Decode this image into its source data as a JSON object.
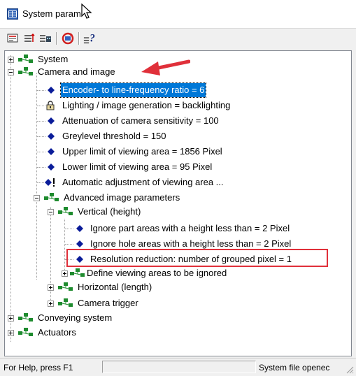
{
  "window": {
    "title": "System param"
  },
  "toolbar": {
    "buttons": [
      "open-icon",
      "save-icon",
      "find-icon",
      "refresh-icon",
      "help-icon"
    ],
    "help_glyph": "?"
  },
  "tree": {
    "items": [
      {
        "label": "System"
      },
      {
        "label": "Camera and image"
      },
      {
        "label": "Encoder- to line-frequency ratio = 6"
      },
      {
        "label": "Lighting / image generation = backlighting"
      },
      {
        "label": "Attenuation of camera sensitivity = 100"
      },
      {
        "label": "Greylevel threshold = 150"
      },
      {
        "label": "Upper limit of viewing area = 1856 Pixel"
      },
      {
        "label": "Lower limit of viewing area = 95 Pixel"
      },
      {
        "label": "Automatic adjustment of viewing area ..."
      },
      {
        "label": "Advanced image parameters"
      },
      {
        "label": "Vertical (height)"
      },
      {
        "label": "Ignore part areas with a height less than = 2 Pixel"
      },
      {
        "label": "Ignore hole areas with a height less than = 2 Pixel"
      },
      {
        "label": "Resolution reduction: number of grouped pixel = 1"
      },
      {
        "label": "Define viewing areas to be ignored"
      },
      {
        "label": "Horizontal (length)"
      },
      {
        "label": "Camera trigger"
      },
      {
        "label": "Conveying system"
      },
      {
        "label": "Actuators"
      }
    ]
  },
  "statusbar": {
    "help_text": "For Help, press F1",
    "file_text": "System file openec"
  },
  "colors": {
    "selection": "#0078d7",
    "highlight_box": "#e0303a",
    "arrow": "#e0303a",
    "diamond": "#0a1c99"
  }
}
